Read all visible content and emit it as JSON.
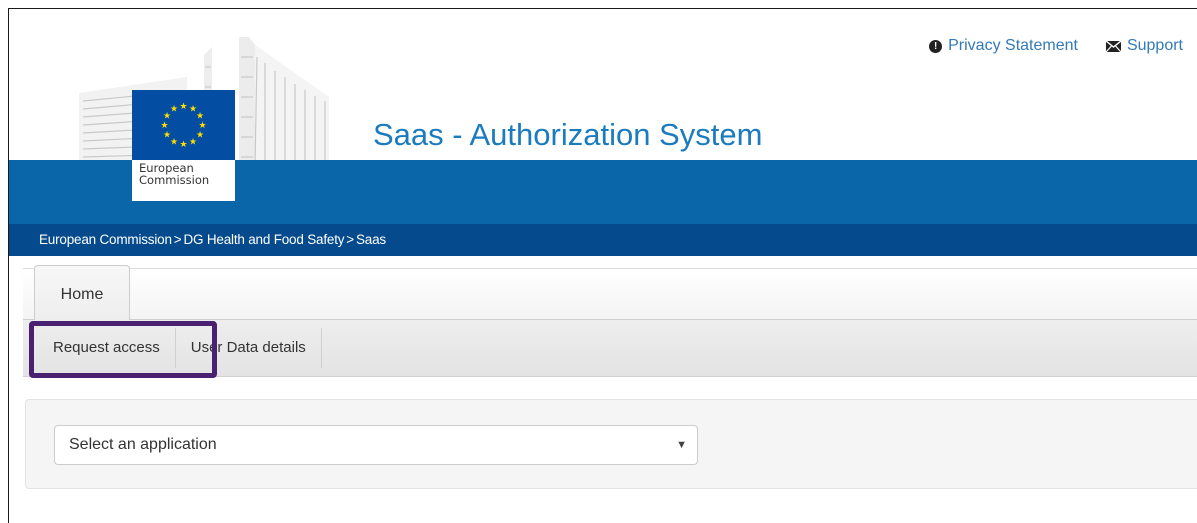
{
  "header": {
    "links": [
      {
        "label": "Privacy Statement",
        "icon": "exclamation-circle-icon"
      },
      {
        "label": "Support",
        "icon": "envelope-icon"
      }
    ],
    "logo": {
      "line1": "European",
      "line2": "Commission"
    },
    "site_title": "Saas - Authorization System"
  },
  "breadcrumb": {
    "items": [
      "European Commission",
      "DG Health and Food Safety",
      "Saas"
    ],
    "separator": ">"
  },
  "tabs": {
    "home": "Home"
  },
  "subnav": {
    "items": [
      "Request access",
      "User Data details"
    ],
    "highlighted": "Request access"
  },
  "form": {
    "application_select": {
      "placeholder": "Select an application",
      "icon": "caret-down-icon"
    }
  },
  "colors": {
    "banner": "#0a66a8",
    "breadcrumb_bar": "#044a8c",
    "link": "#337ab7",
    "title": "#1a7bbf",
    "highlight": "#4a2071",
    "flag_blue": "#034ea2"
  }
}
